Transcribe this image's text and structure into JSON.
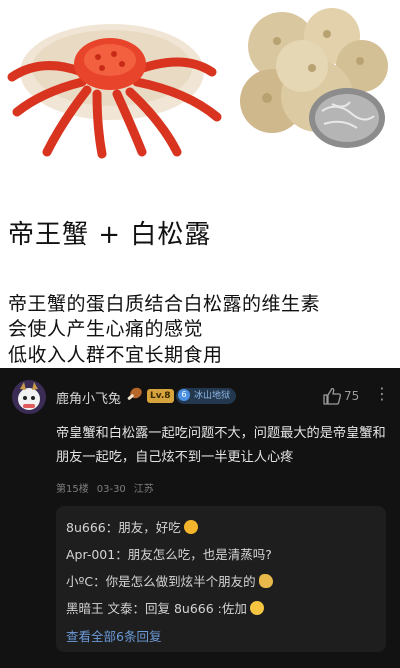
{
  "meme": {
    "title": "帝王蟹 + 白松露",
    "lines": [
      "帝王蟹的蛋白质结合白松露的维生素",
      "会使人产生心痛的感觉",
      "低收入人群不宜长期食用"
    ]
  },
  "comment": {
    "username": "鹿角小飞兔",
    "level": "Lv.8",
    "badge": "冰山地狱",
    "likes": "75",
    "text": "帝皇蟹和白松露一起吃问题不大，问题最大的是帝皇蟹和朋友一起吃，自己炫不到一半更让人心疼",
    "floor": "第15楼",
    "date": "03-30",
    "location": "江苏",
    "replies": [
      {
        "text": "8u666：朋友，好吃"
      },
      {
        "text": "Apr-001：朋友怎么吃，也是清蒸吗?"
      },
      {
        "text": "小ºC：你是怎么做到炫半个朋友的"
      },
      {
        "text": "黑暗王 文泰：回复 8u666 :佐加"
      }
    ],
    "see_all": "查看全部6条回复"
  }
}
